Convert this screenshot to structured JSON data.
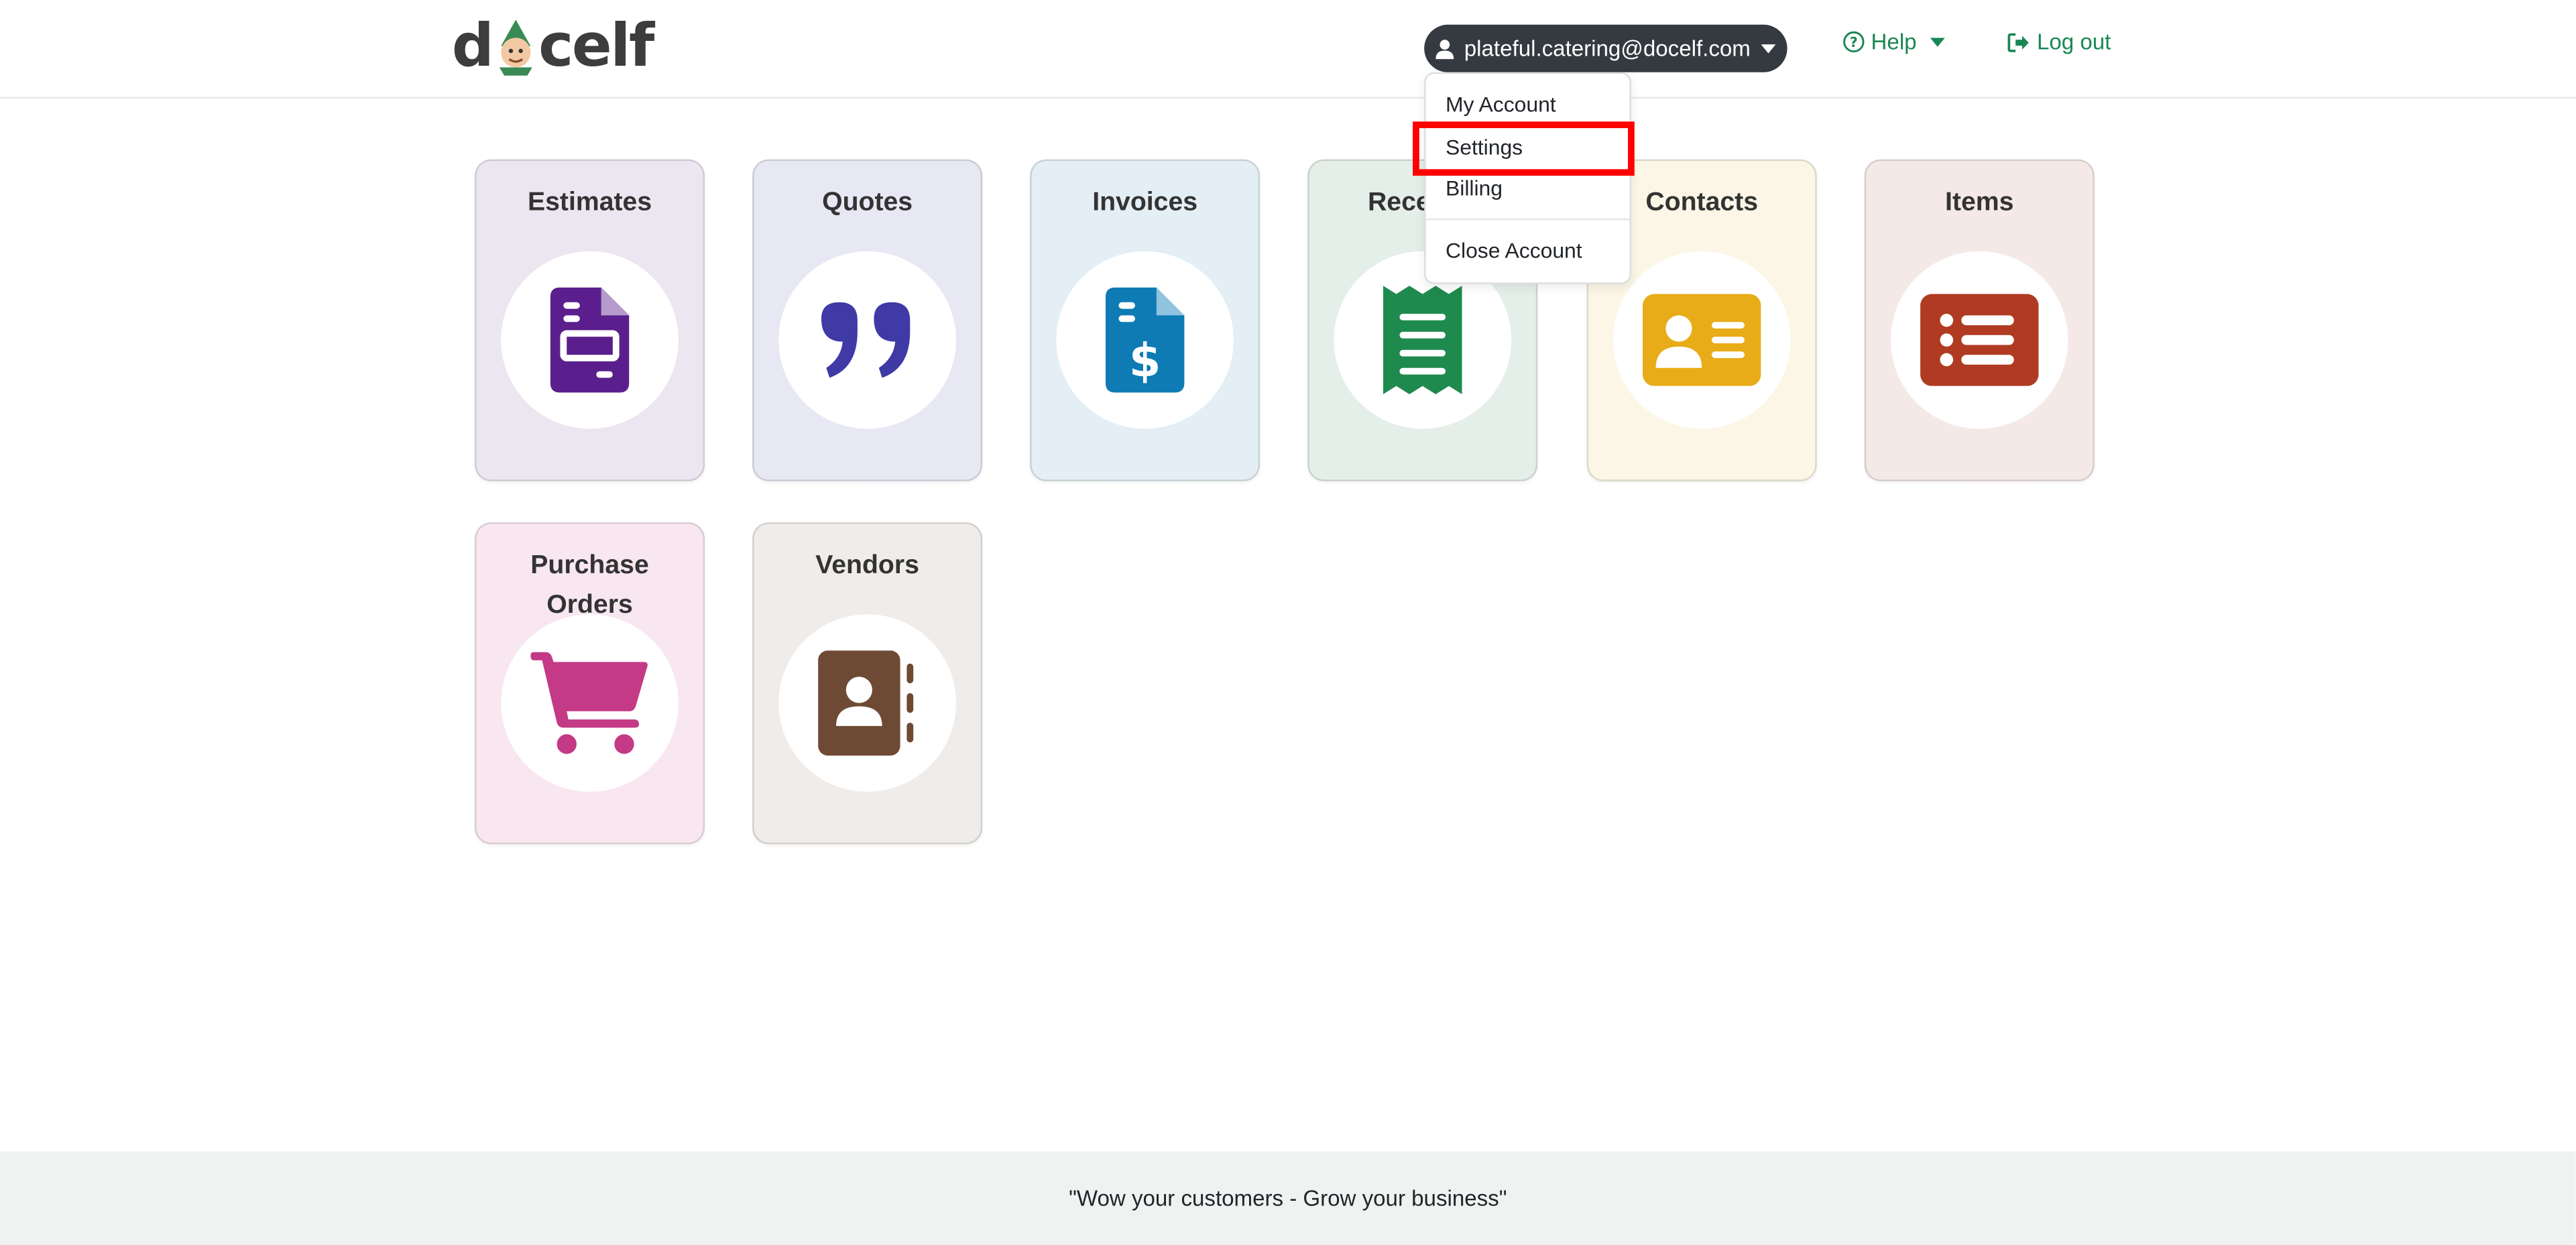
{
  "header": {
    "logo_text_left": "d",
    "logo_text_right": "celf",
    "user_email": "plateful.catering@docelf.com",
    "help_label": "Help",
    "logout_label": "Log out"
  },
  "user_menu": {
    "items": [
      "My Account",
      "Settings",
      "Billing",
      "Close Account"
    ],
    "highlighted": "Settings"
  },
  "tiles": [
    {
      "label": "Estimates",
      "color": "#5a1f8c",
      "bg": "#ece6f0",
      "icon": "file-invoice-icon"
    },
    {
      "label": "Quotes",
      "color": "#3f3aa6",
      "bg": "#e8e8f5",
      "icon": "quote-icon"
    },
    {
      "label": "Invoices",
      "color": "#0e7bb5",
      "bg": "#e3eef5",
      "icon": "file-dollar-icon"
    },
    {
      "label": "Receipts",
      "color": "#1f8a4d",
      "bg": "#e5efe9",
      "icon": "receipt-icon"
    },
    {
      "label": "Contacts",
      "color": "#e8ac18",
      "bg": "#fbf6e6",
      "icon": "address-card-icon"
    },
    {
      "label": "Items",
      "color": "#b03a22",
      "bg": "#f5e9e7",
      "icon": "list-icon"
    },
    {
      "label": "Purchase Orders",
      "color": "#c43a86",
      "bg": "#f8e7f0",
      "icon": "cart-icon"
    },
    {
      "label": "Vendors",
      "color": "#6e4a34",
      "bg": "#efece9",
      "icon": "address-book-icon"
    }
  ],
  "footer": {
    "tagline": "\"Wow your customers - Grow your business\""
  },
  "colors": {
    "accent_green": "#198754",
    "pill_dark": "#343a40",
    "highlight_red": "#ff0000"
  }
}
